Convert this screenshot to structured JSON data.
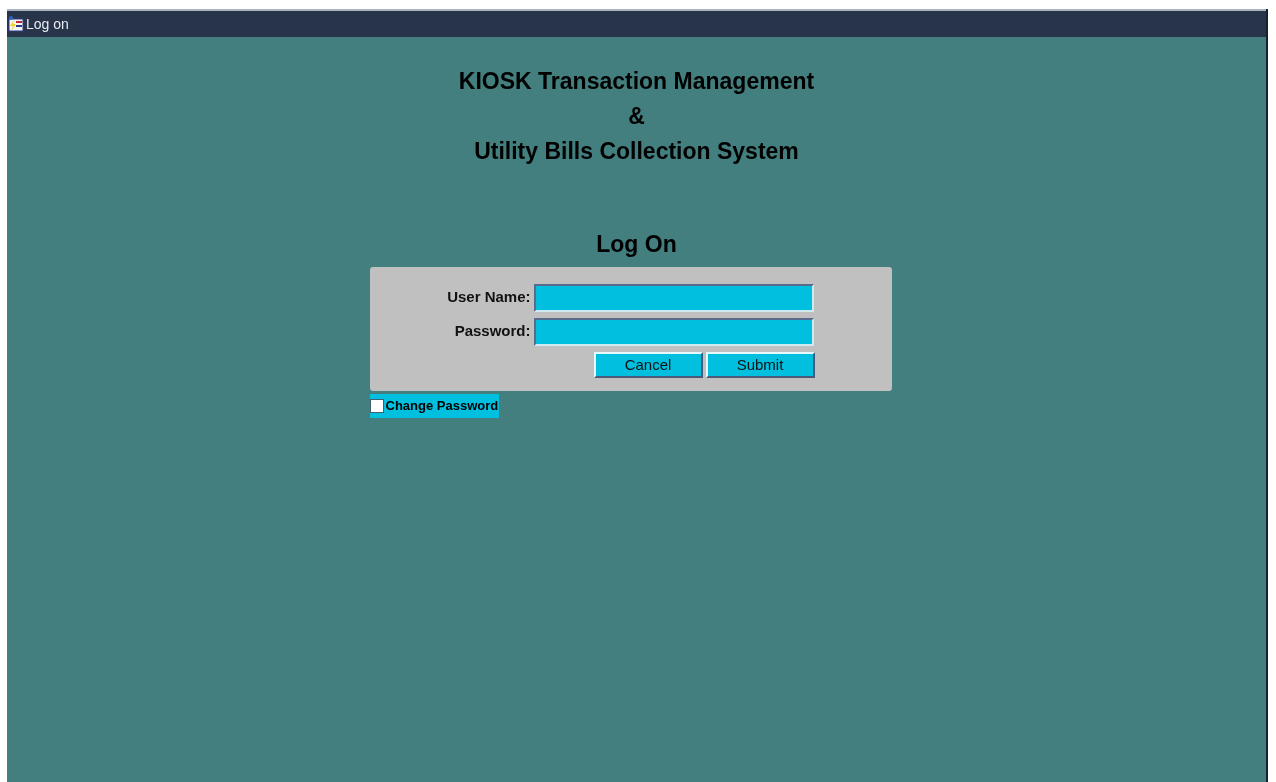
{
  "window": {
    "title": "Log on"
  },
  "heading": [
    "KIOSK Transaction Management",
    "&",
    "Utility Bills Collection System"
  ],
  "form": {
    "title": "Log On",
    "fields": [
      {
        "label": "User Name:"
      },
      {
        "label": "Password:"
      }
    ],
    "buttons": [
      "Cancel",
      "Submit"
    ]
  },
  "change_password": {
    "label": "Change Password",
    "checked": false
  }
}
